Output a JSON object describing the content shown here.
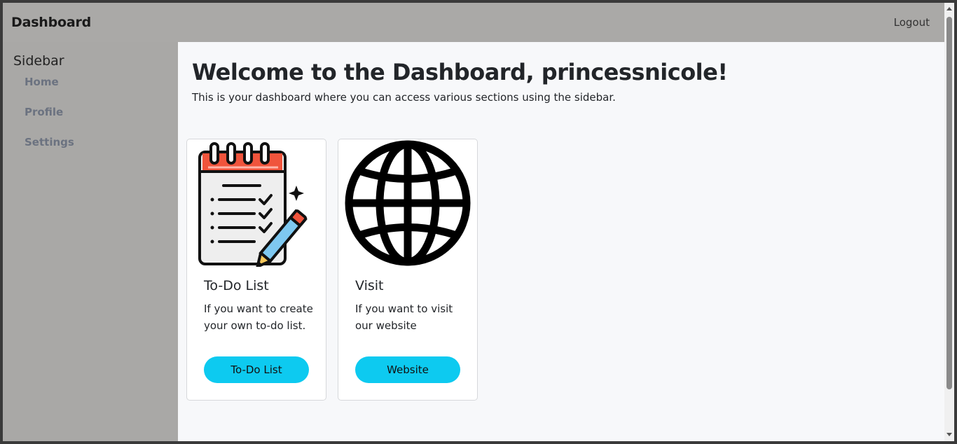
{
  "navbar": {
    "brand": "Dashboard",
    "logout_label": "Logout"
  },
  "sidebar": {
    "title": "Sidebar",
    "items": [
      {
        "label": "Home"
      },
      {
        "label": "Profile"
      },
      {
        "label": "Settings"
      }
    ]
  },
  "main": {
    "title": "Welcome to the Dashboard, princessnicole!",
    "subtitle": "This is your dashboard where you can access various sections using the sidebar.",
    "cards": [
      {
        "icon": "todo-notepad-icon",
        "title": "To-Do List",
        "text": "If you want to create your own to-do list.",
        "button_label": "To-Do List"
      },
      {
        "icon": "globe-icon",
        "title": "Visit",
        "text": "If you want to visit our website",
        "button_label": "Website"
      }
    ]
  },
  "colors": {
    "navbar_bg": "#aaa9a7",
    "sidebar_bg": "#a9a8a6",
    "button_bg": "#0dcaf0",
    "main_bg": "#f7f8fa"
  }
}
